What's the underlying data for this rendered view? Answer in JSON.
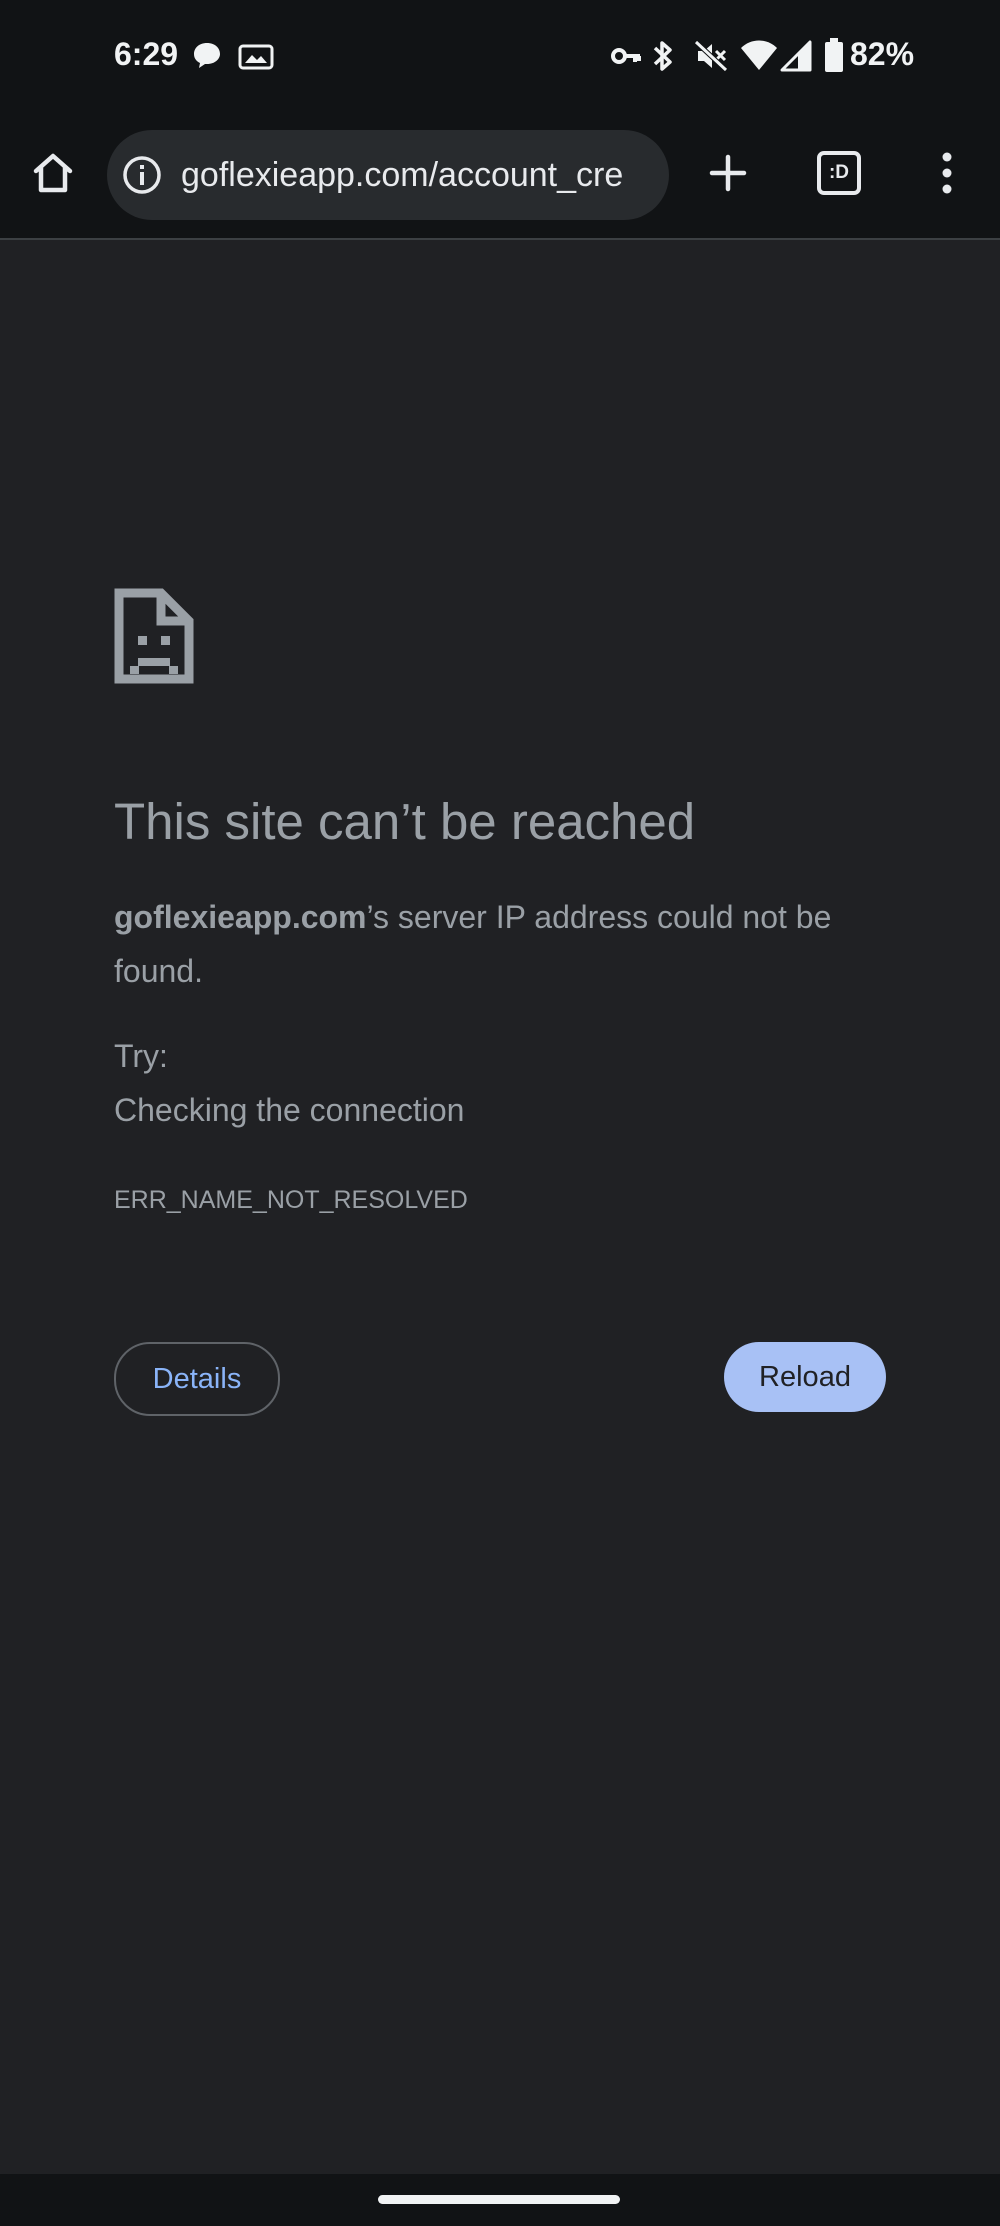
{
  "status_bar": {
    "time": "6:29",
    "battery_percent": "82%",
    "icons": [
      "chat-icon",
      "photo-icon",
      "vpn-key-icon",
      "bluetooth-icon",
      "mute-icon",
      "wifi-icon",
      "cell-signal-icon",
      "battery-icon"
    ]
  },
  "toolbar": {
    "url": "goflexieapp.com/account_cre",
    "tab_switcher_label": ":D",
    "icons": [
      "home-icon",
      "info-icon",
      "plus-icon",
      "tab-switcher-icon",
      "overflow-menu-icon"
    ]
  },
  "error_page": {
    "title": "This site can’t be reached",
    "domain": "goflexieapp.com",
    "message_suffix": "’s server IP address could not be found.",
    "try_label": "Try:",
    "suggestion": "Checking the connection",
    "error_code": "ERR_NAME_NOT_RESOLVED",
    "details_label": "Details",
    "reload_label": "Reload"
  },
  "colors": {
    "page_background": "#202124",
    "bar_background": "#111315",
    "reload_button": "#a8c1f5",
    "details_text": "#8ab4f8",
    "muted_text": "#9aa0a6"
  }
}
